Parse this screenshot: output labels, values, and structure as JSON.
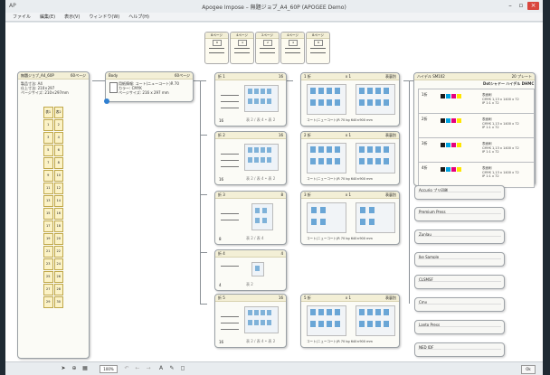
{
  "window": {
    "title": "Apogee Impose – 無題ジョブ_A4_60P (APOGEE Demo)",
    "app_icon": "AP",
    "min": "–",
    "max": "▫",
    "close": "×"
  },
  "menu": [
    "ファイル",
    "編集(E)",
    "表示(V)",
    "ウィンドウ(W)",
    "ヘルプ(H)"
  ],
  "templates": [
    {
      "label": "8ページ",
      "box": "8"
    },
    {
      "label": "4ページ",
      "box": "4"
    },
    {
      "label": "2ページ",
      "box": "2"
    },
    {
      "label": "4ページ",
      "box": "4"
    },
    {
      "label": "8ページ",
      "box": "8"
    }
  ],
  "job": {
    "header_left": "無題ジョブ_A4_60P",
    "header_right": "60ページ",
    "lines": [
      "製品寸法: A4",
      "仕上寸法: 210×297",
      "ページサイズ: 210×297mm"
    ],
    "cells": [
      [
        "表1",
        "表2"
      ],
      [
        "1",
        "2"
      ],
      [
        "3",
        "4"
      ],
      [
        "5",
        "6"
      ],
      [
        "7",
        "8"
      ],
      [
        "9",
        "10"
      ],
      [
        "11",
        "12"
      ],
      [
        "13",
        "14"
      ],
      [
        "15",
        "16"
      ],
      [
        "17",
        "18"
      ],
      [
        "19",
        "20"
      ],
      [
        "21",
        "22"
      ],
      [
        "23",
        "24"
      ],
      [
        "25",
        "26"
      ],
      [
        "27",
        "28"
      ],
      [
        "29",
        "30"
      ]
    ]
  },
  "body": {
    "header_left": "Body",
    "header_right": "60ページ",
    "lines": [
      "用紙情報: コート(ニューコート)R 70",
      "カラー: CMYK",
      "ページサイズ: 216 x 297 mm"
    ]
  },
  "impositions": [
    {
      "name": "折 1",
      "pages": "16",
      "count": "16",
      "caption": "表 2 / 表 4 • 表 2"
    },
    {
      "name": "折 2",
      "pages": "16",
      "count": "16",
      "caption": "表 2 / 表 4 • 表 2"
    },
    {
      "name": "折 3",
      "pages": "8",
      "count": "8",
      "caption": "表 2 / 表 4"
    },
    {
      "name": "折 4",
      "pages": "4",
      "count": "4",
      "caption": "表 2"
    },
    {
      "name": "折 5",
      "pages": "16",
      "count": "16",
      "caption": "表 2 / 表 4 • 表 2"
    }
  ],
  "signatures": [
    {
      "name": "1 折",
      "copies": "x 1",
      "type": "表裏別",
      "footer": "コート(ニューコート)R 70   kg   640×900 mm"
    },
    {
      "name": "2 折",
      "copies": "x 1",
      "type": "表裏別",
      "footer": "コート(ニューコート)R 70   kg   640×900 mm"
    },
    {
      "name": "3 折",
      "copies": "x 1",
      "type": "表裏別",
      "footer": "コート(ニューコート)R 70   kg   640×900 mm"
    },
    {
      "name": "5 折",
      "copies": "x 1",
      "type": "表裏別",
      "footer": "コート(ニューコート)R 70   kg   640×900 mm"
    }
  ],
  "output": {
    "header_left": "ハイデル SM102",
    "header_right": "20 プレート",
    "subtitle": "Dotシャドー ハイデル DHMC",
    "rows": [
      {
        "label": "1折",
        "info": [
          "表面刷",
          "CMYK 1,13 x 1400 x 72",
          "IP 1:1 x 72"
        ]
      },
      {
        "label": "2折",
        "info": [
          "表面刷",
          "CMYK 1,13 x 1400 x 72",
          "IP 1:1 x 72"
        ]
      },
      {
        "label": "3折",
        "info": [
          "表面刷",
          "CMYK 1,13 x 1400 x 72",
          "IP 1:1 x 72"
        ]
      },
      {
        "label": "4折",
        "info": [
          "表面刷",
          "CMYK 1,13 x 1400 x 72",
          "IP 1:1 x 72"
        ]
      }
    ],
    "swatch_colors": [
      "#1a1a1a",
      "#00a3e0",
      "#e6007e",
      "#ffe500"
    ]
  },
  "devices": [
    "Accurio プリ印刷",
    "Premium Press",
    "Zunlau",
    "Ike Sample",
    "CLSMSF",
    "Cmy",
    "Lanto Press",
    "NED JDF"
  ],
  "statusbar": {
    "zoom": "100%",
    "right": "Ok"
  },
  "accent": "#f3efd6"
}
